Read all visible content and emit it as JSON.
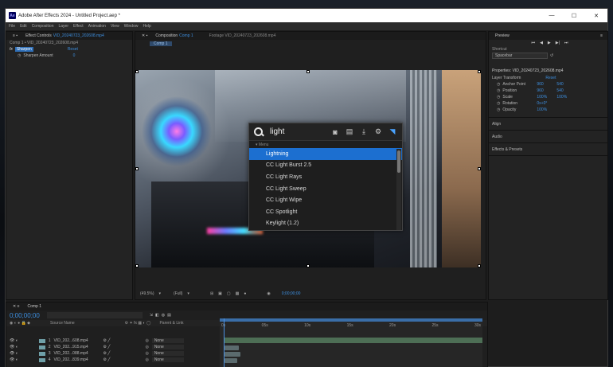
{
  "window": {
    "title": "Adobe After Effects 2024 - Untitled Project.aep *",
    "logo_text": "Ae",
    "controls": [
      "—",
      "☐",
      "✕"
    ]
  },
  "menu": [
    "File",
    "Edit",
    "Composition",
    "Layer",
    "Effect",
    "Animation",
    "View",
    "Window",
    "Help"
  ],
  "effect_controls": {
    "tab_label": "Effect Controls",
    "tab_file": "VID_20240723_202608.mp4",
    "breadcrumb": "Comp 1 • VID_20240723_202608.mp4",
    "fx_label": "fx",
    "effect_name": "Sharpen",
    "reset_label": "Reset",
    "property_label": "Sharpen Amount",
    "property_value": "0"
  },
  "composition": {
    "tab_label": "Composition",
    "tab_comp": "Comp 1",
    "footage_tab": "Footage  VID_20240723_202608.mp4",
    "comp_button": "Comp 1",
    "zoom": "(49.5%)",
    "resolution": "(Full)",
    "timecode": "0;00;00;00"
  },
  "effects_search": {
    "query": "light",
    "header": "▾ Menu",
    "icons": [
      "camera-icon",
      "film-icon",
      "download-icon",
      "gear-icon",
      "send-icon"
    ],
    "results": [
      "Lightning",
      "CC Light Burst 2.5",
      "CC Light Rays",
      "CC Light Sweep",
      "CC Light Wipe",
      "CC Spotlight",
      "Keylight (1.2)"
    ],
    "selected_index": 0
  },
  "preview": {
    "title": "Preview",
    "shortcut_label": "Shortcut",
    "shortcut_value": "Spacebar"
  },
  "properties": {
    "title": "Properties: VID_20240723_202608.mp4",
    "section": "Layer Transform",
    "reset_label": "Reset",
    "rows": [
      {
        "label": "Anchor Point",
        "v1": "960",
        "v2": "540"
      },
      {
        "label": "Position",
        "v1": "960",
        "v2": "540"
      },
      {
        "label": "Scale",
        "v1": "100%",
        "v2": "100%"
      },
      {
        "label": "Rotation",
        "v1": "0x+0°",
        "v2": ""
      },
      {
        "label": "Opacity",
        "v1": "100%",
        "v2": ""
      }
    ],
    "more": [
      "Align",
      "Audio",
      "Effects & Presets"
    ]
  },
  "timeline": {
    "tab_label": "Comp 1",
    "timecode": "0;00;00;00",
    "column_source": "Source Name",
    "column_parent": "Parent & Link",
    "ruler": [
      "0s",
      "05s",
      "10s",
      "15s",
      "20s",
      "25s",
      "30s"
    ],
    "layers": [
      {
        "num": "1",
        "name": "VID_202...608.mp4",
        "parent": "None"
      },
      {
        "num": "2",
        "name": "VID_202...915.mp4",
        "parent": "None"
      },
      {
        "num": "3",
        "name": "VID_202...088.mp4",
        "parent": "None"
      },
      {
        "num": "4",
        "name": "VID_202...839.mp4",
        "parent": "None"
      }
    ]
  }
}
